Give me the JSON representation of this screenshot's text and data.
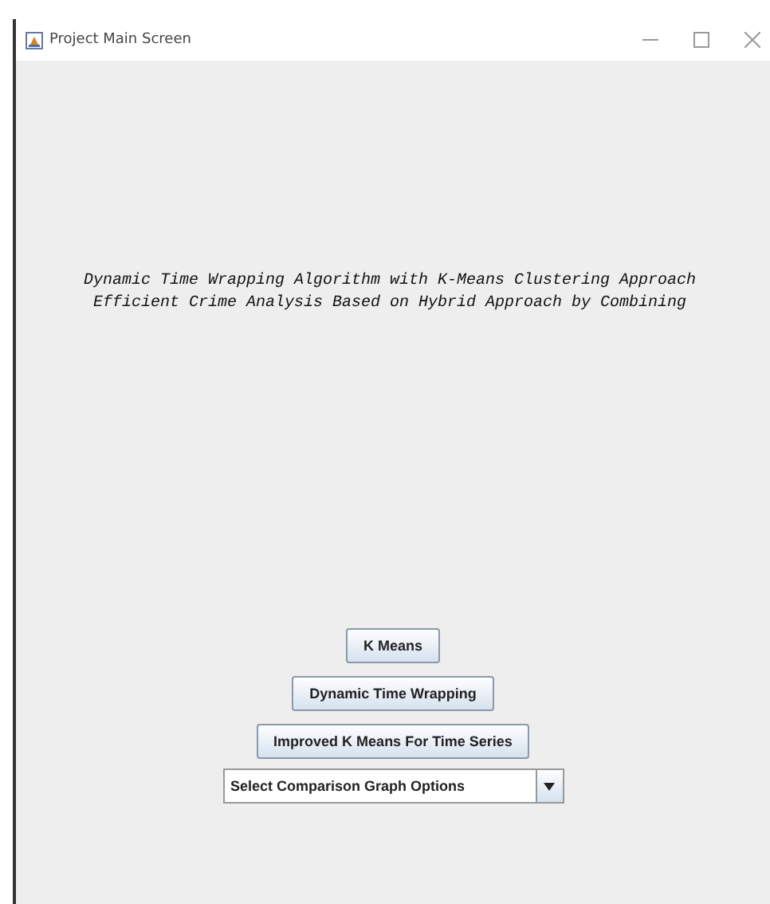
{
  "window": {
    "title": "Project Main Screen"
  },
  "heading_lines": [
    "Dynamic Time Wrapping Algorithm with K-Means Clustering Approach",
    "Efficient Crime Analysis Based on Hybrid Approach by Combining"
  ],
  "buttons": [
    "K Means",
    "Dynamic Time Wrapping",
    "Improved K Means For Time Series"
  ],
  "dropdown": {
    "value": "Select Comparison Graph Options"
  }
}
